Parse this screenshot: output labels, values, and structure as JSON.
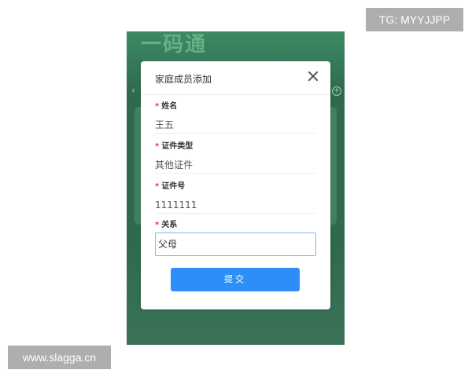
{
  "watermarks": {
    "top_right": "TG: MYYJJPP",
    "bottom_left": "www.slagga.cn"
  },
  "background_app": {
    "banner_text": "一码通"
  },
  "dialog": {
    "title": "家庭成员添加",
    "close_icon": "close-icon",
    "required_marker": "*",
    "fields": [
      {
        "label": "姓名",
        "value": "王五"
      },
      {
        "label": "证件类型",
        "value": "其他证件"
      },
      {
        "label": "证件号",
        "value": "1111111"
      },
      {
        "label": "关系",
        "value": "父母"
      }
    ],
    "submit_label": "提交"
  },
  "colors": {
    "accent": "#2c8ef8",
    "required": "#e23b3b",
    "background_green": "#2f6a4f"
  }
}
